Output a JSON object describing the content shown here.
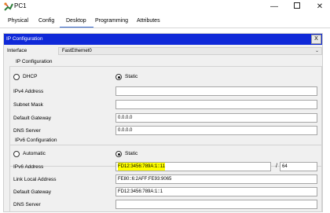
{
  "window": {
    "title": "PC1",
    "min_glyph": "—",
    "close_glyph": "✕"
  },
  "tabs": [
    "Physical",
    "Config",
    "Desktop",
    "Programming",
    "Attributes"
  ],
  "active_tab": "Desktop",
  "panel": {
    "title": "IP Configuration",
    "close_label": "X",
    "interface_label": "Interface",
    "interface_value": "FastEthernet0",
    "ipv4": {
      "legend": "IP Configuration",
      "dhcp_label": "DHCP",
      "static_label": "Static",
      "mode": "Static",
      "ipv4_label": "IPv4 Address",
      "ipv4_value": "",
      "subnet_label": "Subnet Mask",
      "subnet_value": "",
      "gateway_label": "Default Gateway",
      "gateway_value": "0.0.0.0",
      "dns_label": "DNS Server",
      "dns_value": "0.0.0.0"
    },
    "ipv6": {
      "legend": "IPv6 Configuration",
      "auto_label": "Automatic",
      "static_label": "Static",
      "mode": "Static",
      "ipv6_label": "IPv6 Address",
      "ipv6_value": "FD12:3456:789A:1::11",
      "slash": "/",
      "prefix_value": "64",
      "link_local_label": "Link Local Address",
      "link_local_value": "FE80::6:2AFF:FE93:9065",
      "gateway_label": "Default Gateway",
      "gateway_value": "FD12:3456:789A:1::1",
      "dns_label": "DNS Server",
      "dns_value": ""
    }
  },
  "colors": {
    "panel_header": "#0f29d8",
    "tab_underline": "#3366cc",
    "highlight": "#ffff00"
  }
}
